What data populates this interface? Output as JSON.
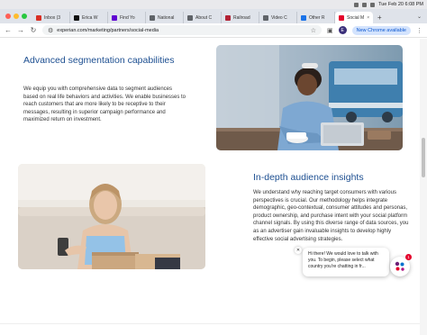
{
  "menubar": {
    "datetime": "Tue Feb 20  6:08 PM"
  },
  "tabs": [
    {
      "label": "Inbox (3",
      "favicon": "gmail-icon",
      "color": "#d93025"
    },
    {
      "label": "Erica W",
      "favicon": "x-icon",
      "color": "#111111"
    },
    {
      "label": "Find Yo",
      "favicon": "yahoo-icon",
      "color": "#6001d2"
    },
    {
      "label": "National",
      "favicon": "globe-icon",
      "color": "#5f6368"
    },
    {
      "label": "About C",
      "favicon": "globe-icon",
      "color": "#5f6368"
    },
    {
      "label": "Railroad",
      "favicon": "us-flag-icon",
      "color": "#b22234"
    },
    {
      "label": "Video C",
      "favicon": "globe-icon",
      "color": "#5f6368"
    },
    {
      "label": "Other R",
      "favicon": "document-icon",
      "color": "#1a73e8"
    },
    {
      "label": "Social M",
      "favicon": "experian-icon",
      "color": "#e4002b",
      "active": true
    }
  ],
  "toolbar": {
    "url": "experian.com/marketing/partners/social-media",
    "new_chrome_label": "New Chrome available",
    "avatar_letter": "E"
  },
  "section1": {
    "title": "Advanced segmentation capabilities",
    "body": "We equip you with comprehensive data to segment audiences based on real life behaviors and activities. We enable businesses to reach customers that are more likely to be receptive to their messages, resulting in superior campaign performance and maximized return on investment."
  },
  "section2": {
    "title": "In-depth audience insights",
    "body": "We understand why reaching target consumers with various perspectives is crucial. Our methodology helps integrate demographic, geo-contextual, consumer attitudes and personas, product ownership, and purchase intent with your social platform channel signals. By using this diverse range of data sources, you as an advertiser gain invaluable insights to develop highly effective social advertising strategies."
  },
  "chat": {
    "message": "Hi there! We would love to talk with you. To begin, please select what country you're chatting in fr...",
    "badge": "1"
  },
  "colors": {
    "heading": "#1d4f91",
    "accent": "#0b57d0"
  }
}
